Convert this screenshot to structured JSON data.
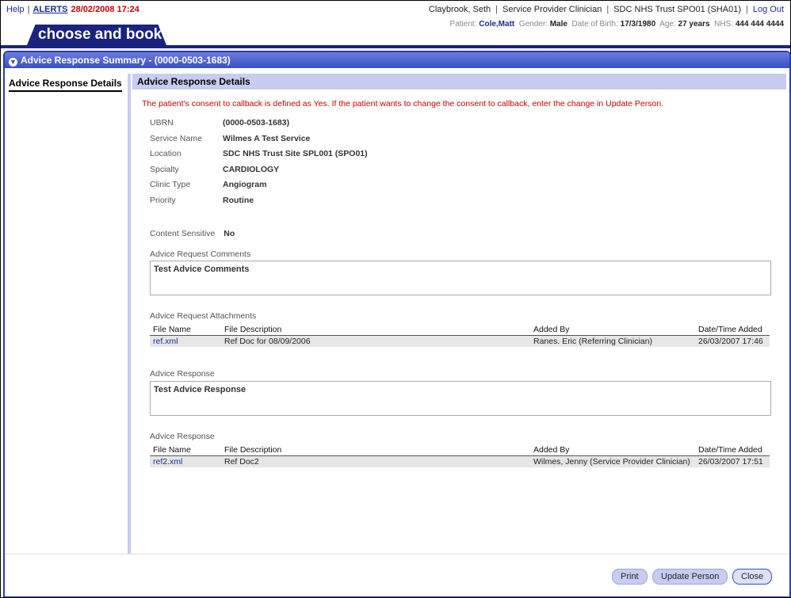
{
  "header": {
    "help": "Help",
    "alerts": "ALERTS",
    "alerts_datetime": "28/02/2008 17:24",
    "logo_text": "choose and book",
    "user": "Claybrook, Seth",
    "role": "Service Provider Clinician",
    "org": "SDC NHS Trust SPO01 (SHA01)",
    "logout": "Log Out",
    "patient_label": "Patient:",
    "patient_name": "Cole,Matt",
    "gender_label": "Gender:",
    "gender": "Male",
    "dob_label": "Date of Birth:",
    "dob": "17/3/1980",
    "age_label": "Age:",
    "age": "27 years",
    "nhs_label": "NHS:",
    "nhs": "444 444 4444"
  },
  "window": {
    "title": "Advice Response Summary - (0000-0503-1683)"
  },
  "nav": {
    "item": "Advice Response Details"
  },
  "main": {
    "section_title": "Advice Response Details",
    "notice": "The patient's consent to callback is defined as Yes. If the patient wants to change the consent to callback, enter the change in Update Person.",
    "fields": [
      {
        "label": "UBRN",
        "value": "(0000-0503-1683)"
      },
      {
        "label": "Service Name",
        "value": "Wilmes A Test Service"
      },
      {
        "label": "Location",
        "value": "SDC NHS Trust Site SPL001 (SPO01)"
      },
      {
        "label": "Spcialty",
        "value": "CARDIOLOGY"
      },
      {
        "label": "Clinic Type",
        "value": "Angiogram"
      },
      {
        "label": "Priority",
        "value": "Routine"
      }
    ],
    "content_sensitive_label": "Content Sensitive",
    "content_sensitive_value": "No",
    "request_comments_label": "Advice Request Comments",
    "request_comments": "Test Advice Comments",
    "request_attachments_label": "Advice Request Attachments",
    "table_headers": [
      "File Name",
      "File Description",
      "Added By",
      "Date/Time Added"
    ],
    "request_attachments": [
      {
        "file": "ref.xml",
        "desc": "Ref Doc for 08/09/2006",
        "added_by": "Ranes. Eric (Referring Clinician)",
        "added": "26/03/2007 17:46"
      }
    ],
    "response_label": "Advice Response",
    "response_text": "Test Advice Response",
    "response_attachments_label": "Advice Response",
    "response_attachments": [
      {
        "file": "ref2.xml",
        "desc": "Ref Doc2",
        "added_by": "Wilmes, Jenny (Service Provider Clinician)",
        "added": "26/03/2007 17:51"
      }
    ]
  },
  "footer": {
    "print": "Print",
    "update_person": "Update Person",
    "close": "Close"
  }
}
